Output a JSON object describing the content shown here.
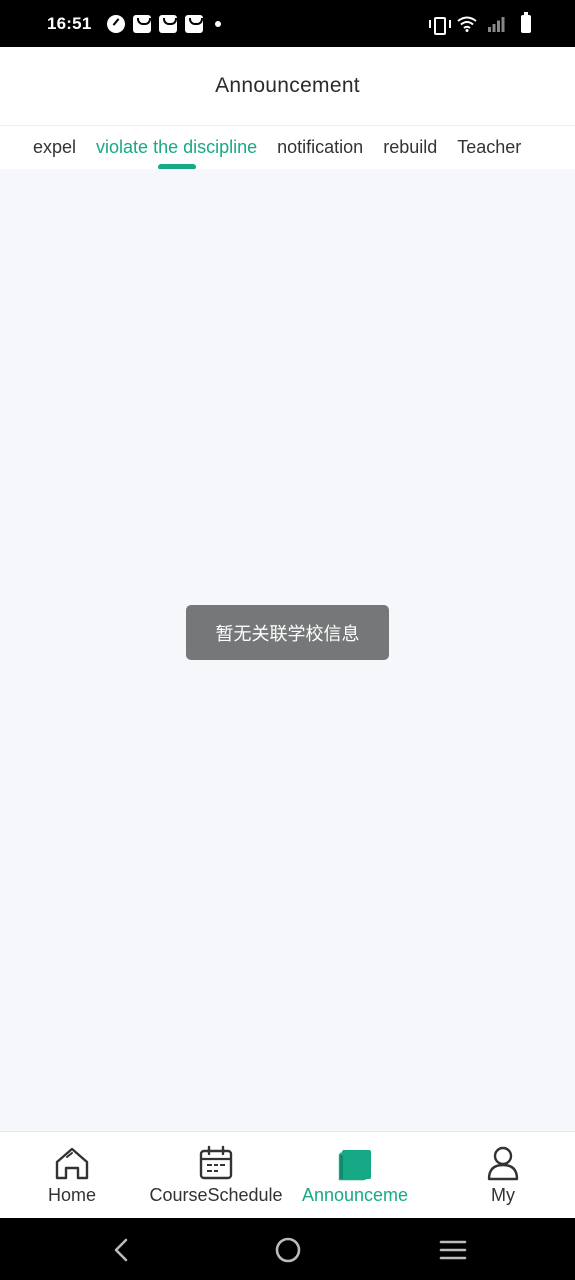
{
  "status_bar": {
    "time": "16:51",
    "left_icons": [
      "speedometer-icon",
      "shopping-bag-icon",
      "shopping-bag-icon",
      "shopping-bag-icon",
      "dot-icon"
    ],
    "right_icons": [
      "vibrate-icon",
      "wifi-icon",
      "signal-icon",
      "battery-icon"
    ]
  },
  "header": {
    "title": "Announcement"
  },
  "tabs": [
    {
      "label": "expel",
      "active": false
    },
    {
      "label": "violate the discipline",
      "active": true
    },
    {
      "label": "notification",
      "active": false
    },
    {
      "label": "rebuild",
      "active": false
    },
    {
      "label": "Teacher",
      "active": false
    }
  ],
  "toast": {
    "message": "暂无关联学校信息"
  },
  "bottom_nav": {
    "items": [
      {
        "label": "Home",
        "icon": "home-icon",
        "active": false
      },
      {
        "label": "CourseSchedule",
        "icon": "calendar-icon",
        "active": false
      },
      {
        "label": "Announceme",
        "icon": "book-icon",
        "active": true
      },
      {
        "label": "My",
        "icon": "user-icon",
        "active": false
      }
    ]
  },
  "system_nav": {
    "icons": [
      "back-icon",
      "home-circle-icon",
      "menu-icon"
    ]
  },
  "colors": {
    "accent": "#17a985",
    "background": "#f6f7fb",
    "toast_bg": "#767778",
    "text": "#333333"
  }
}
